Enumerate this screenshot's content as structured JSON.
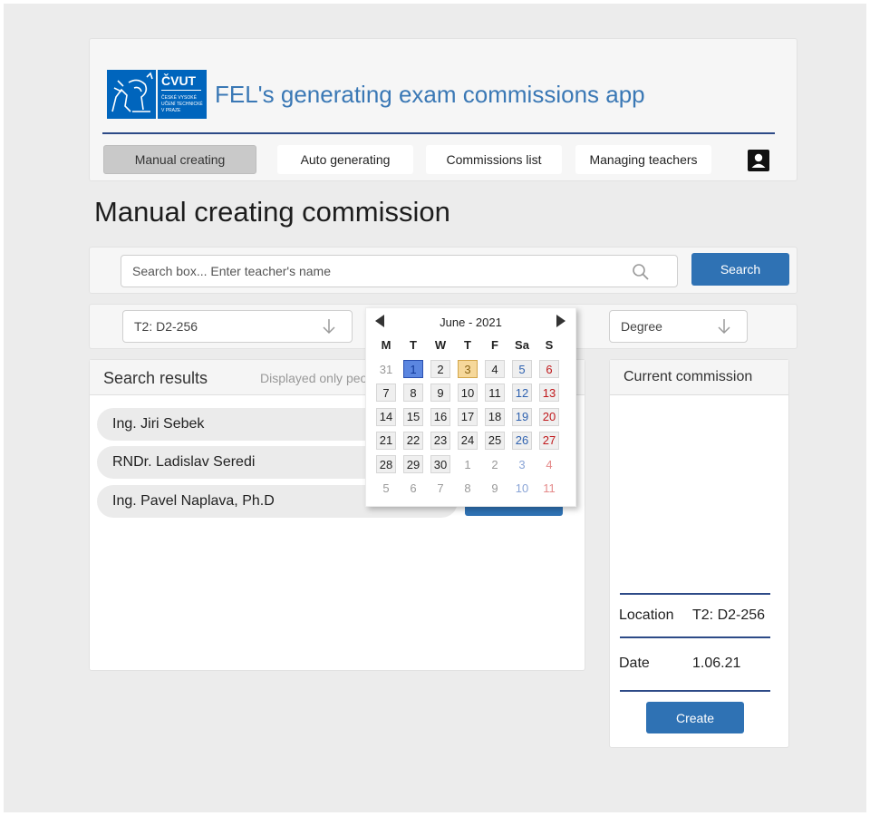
{
  "app": {
    "logo_text": "ČVUT",
    "logo_subtext": "ČESKÉ VYSOKÉ UČENÍ TECHNICKÉ V PRAZE",
    "title": "FEL's generating exam commissions app"
  },
  "nav": {
    "items": [
      {
        "label": "Manual creating",
        "active": true
      },
      {
        "label": "Auto generating",
        "active": false
      },
      {
        "label": "Commissions list",
        "active": false
      },
      {
        "label": "Managing teachers",
        "active": false
      }
    ],
    "profile_icon": "user-profile-icon"
  },
  "page": {
    "title": "Manual creating commission"
  },
  "search": {
    "placeholder": "Search box... Enter teacher's name",
    "button": "Search",
    "icon": "search-icon"
  },
  "filters": {
    "location": "T2: D2-256",
    "degree": "Degree"
  },
  "calendar": {
    "title": "June - 2021",
    "weekdays": [
      "M",
      "T",
      "W",
      "T",
      "F",
      "Sa",
      "S"
    ],
    "selected_day": 1,
    "highlighted_day": 3,
    "weeks": [
      [
        "31",
        "1",
        "2",
        "3",
        "4",
        "5",
        "6"
      ],
      [
        "7",
        "8",
        "9",
        "10",
        "11",
        "12",
        "13"
      ],
      [
        "14",
        "15",
        "16",
        "17",
        "18",
        "19",
        "20"
      ],
      [
        "21",
        "22",
        "23",
        "24",
        "25",
        "26",
        "27"
      ],
      [
        "28",
        "29",
        "30",
        "1",
        "2",
        "3",
        "4"
      ],
      [
        "5",
        "6",
        "7",
        "8",
        "9",
        "10",
        "11"
      ]
    ]
  },
  "results": {
    "title": "Search results",
    "note": "Displayed only peo",
    "people": [
      "Ing. Jiri Sebek",
      "RNDr. Ladislav Seredi",
      "Ing. Pavel Naplava, Ph.D"
    ]
  },
  "commission": {
    "title": "Current commission",
    "location_label": "Location",
    "location_value": "T2: D2-256",
    "date_label": "Date",
    "date_value": "1.06.21",
    "create_button": "Create"
  },
  "colors": {
    "brand_blue": "#2f72b4",
    "title_blue": "#3a78b5",
    "divider_navy": "#2d4a87",
    "logo_blue": "#0065bd"
  }
}
